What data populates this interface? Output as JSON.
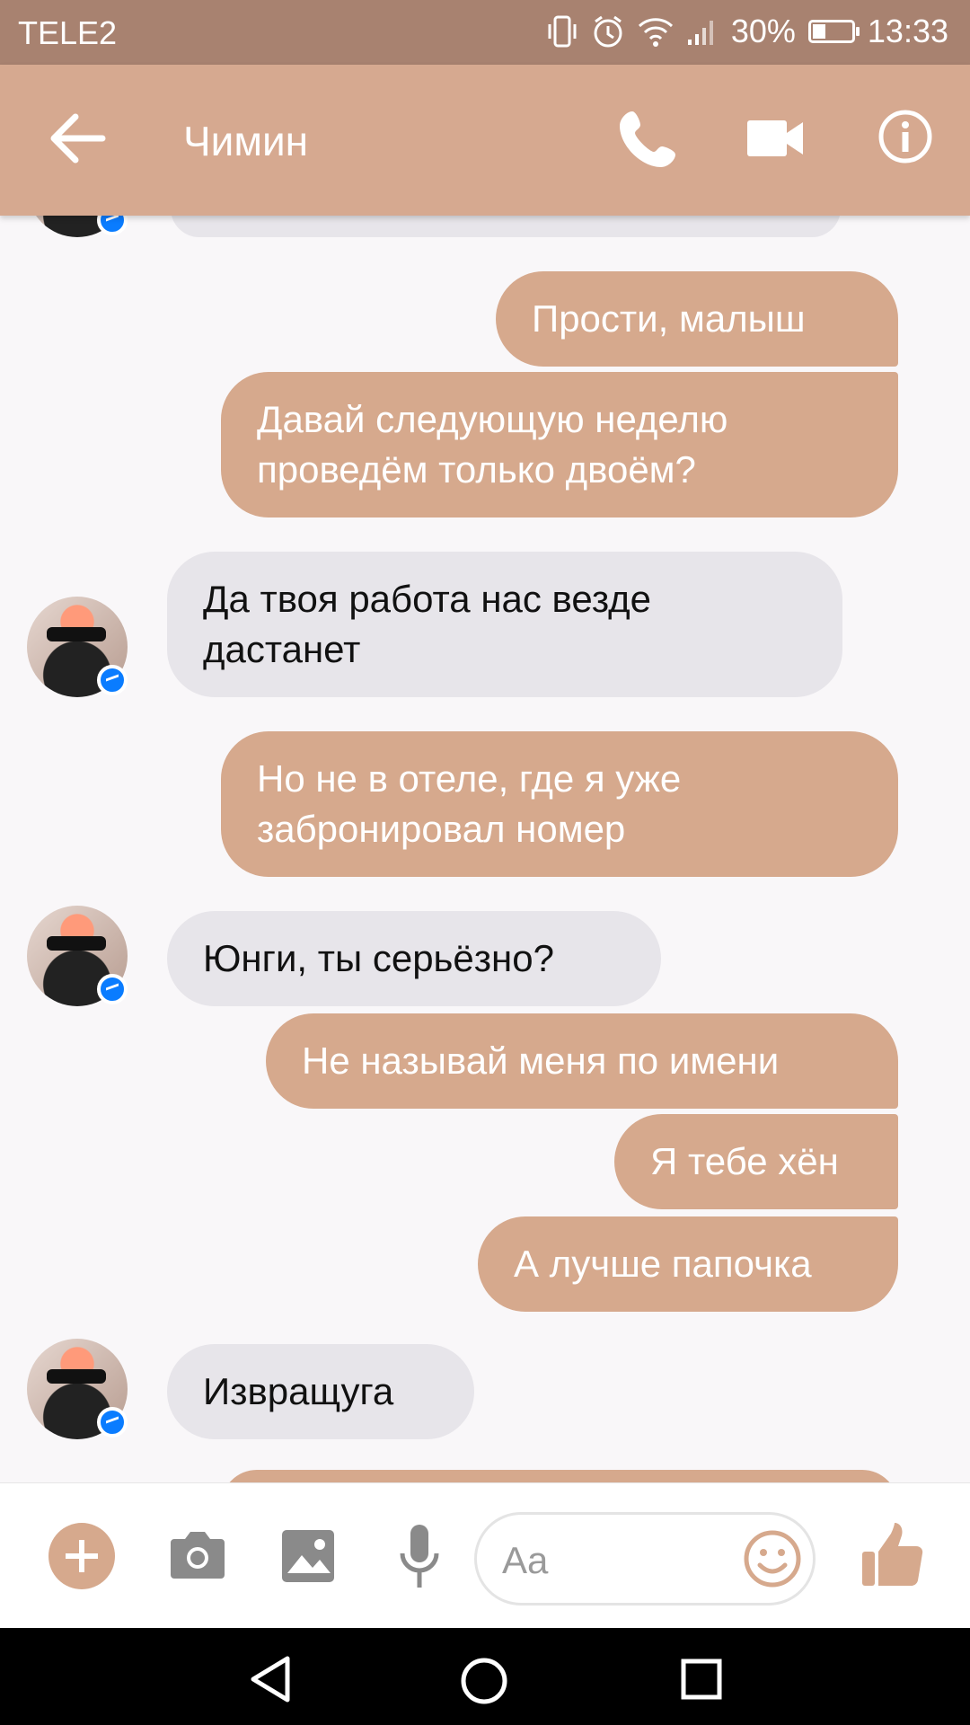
{
  "status_bar": {
    "carrier": "TELE2",
    "battery": "30%",
    "time": "13:33"
  },
  "header": {
    "contact_name": "Чимин"
  },
  "messages": [
    {
      "side": "out",
      "text": "Прости,  малыш"
    },
    {
      "side": "out",
      "text": "Давай следующую неделю\nпроведём только двоём?"
    },
    {
      "side": "in",
      "text": "Да твоя работа нас везде\nдастанет"
    },
    {
      "side": "out",
      "text": "Но не в отеле,  где я уже\nзабронировал номер"
    },
    {
      "side": "in",
      "text": "Юнги,  ты серьёзно?"
    },
    {
      "side": "out",
      "text": "Не называй меня по имени"
    },
    {
      "side": "out",
      "text": "Я тебе хён"
    },
    {
      "side": "out",
      "text": "А лучше папочка"
    },
    {
      "side": "in",
      "text": "Извращуга"
    }
  ],
  "composer": {
    "placeholder": "Aa"
  },
  "colors": {
    "accent": "#d6a98d",
    "app_bar": "#d6a990",
    "status_bar": "#a88270",
    "incoming_bubble": "#e7e5ea",
    "messenger_badge": "#0a7cff"
  },
  "icons": {
    "header": [
      "back-arrow-icon",
      "phone-icon",
      "video-camera-icon",
      "info-icon"
    ],
    "composer": [
      "plus-icon",
      "camera-icon",
      "image-icon",
      "microphone-icon",
      "emoji-icon",
      "thumbs-up-icon"
    ],
    "navigation": [
      "nav-back-icon",
      "nav-home-icon",
      "nav-recents-icon"
    ]
  }
}
